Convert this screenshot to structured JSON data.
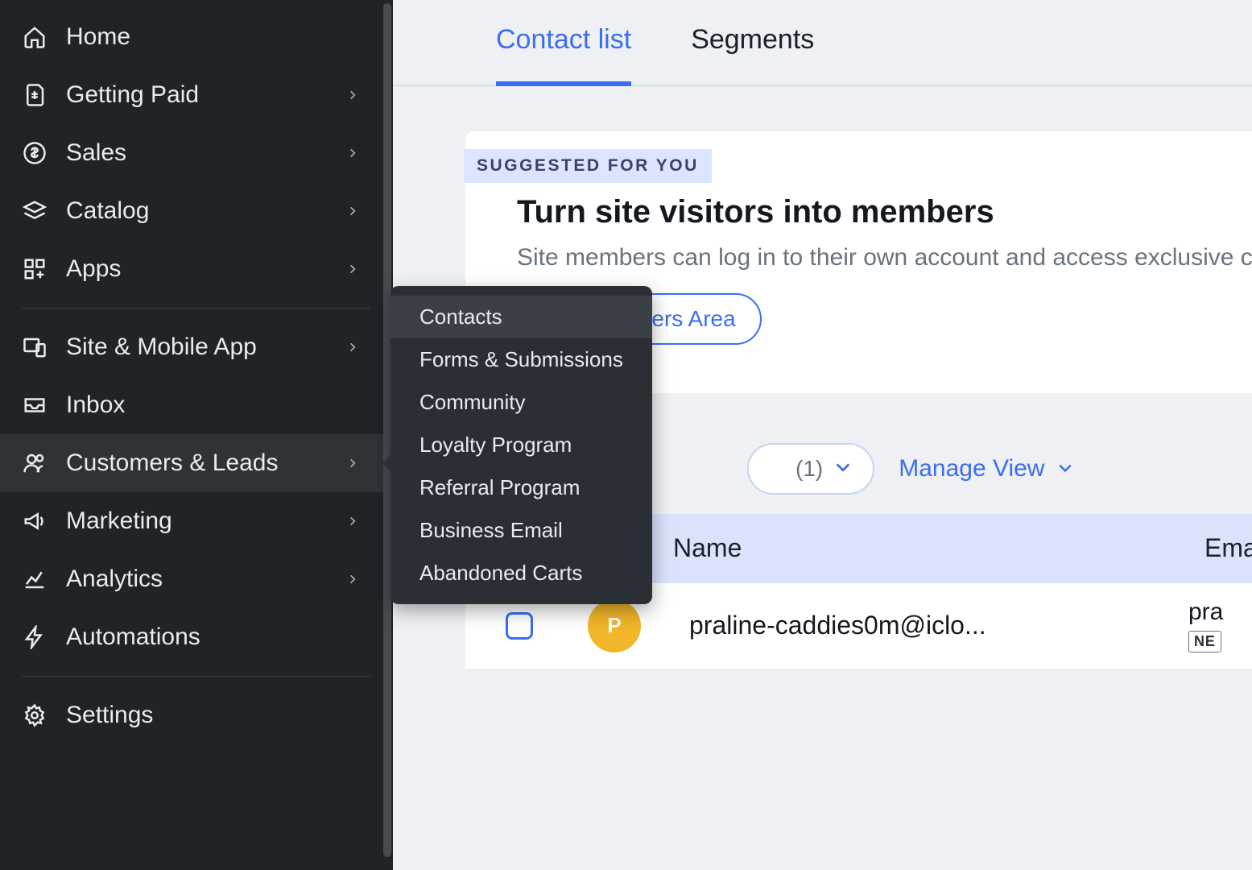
{
  "sidebar": {
    "items": [
      {
        "label": "Home",
        "icon": "home-icon",
        "hasChildren": false
      },
      {
        "label": "Getting Paid",
        "icon": "getting-paid-icon",
        "hasChildren": true
      },
      {
        "label": "Sales",
        "icon": "sales-icon",
        "hasChildren": true
      },
      {
        "label": "Catalog",
        "icon": "catalog-icon",
        "hasChildren": true
      },
      {
        "label": "Apps",
        "icon": "apps-icon",
        "hasChildren": true
      },
      {
        "label": "Site & Mobile App",
        "icon": "site-mobile-icon",
        "hasChildren": true
      },
      {
        "label": "Inbox",
        "icon": "inbox-icon",
        "hasChildren": false
      },
      {
        "label": "Customers & Leads",
        "icon": "customers-icon",
        "hasChildren": true,
        "active": true
      },
      {
        "label": "Marketing",
        "icon": "marketing-icon",
        "hasChildren": true
      },
      {
        "label": "Analytics",
        "icon": "analytics-icon",
        "hasChildren": true
      },
      {
        "label": "Automations",
        "icon": "automations-icon",
        "hasChildren": false
      },
      {
        "label": "Settings",
        "icon": "settings-icon",
        "hasChildren": false
      }
    ],
    "dividers_after": [
      4,
      10
    ]
  },
  "submenu": {
    "items": [
      {
        "label": "Contacts",
        "active": true
      },
      {
        "label": "Forms & Submissions"
      },
      {
        "label": "Community"
      },
      {
        "label": "Loyalty Program"
      },
      {
        "label": "Referral Program"
      },
      {
        "label": "Business Email"
      },
      {
        "label": "Abandoned Carts"
      }
    ]
  },
  "tabs": [
    {
      "label": "Contact list",
      "active": true
    },
    {
      "label": "Segments"
    }
  ],
  "card": {
    "badge": "SUGGESTED FOR YOU",
    "title": "Turn site visitors into members",
    "description": "Site members can log in to their own account and access exclusive content.",
    "cta": "Add Members Area"
  },
  "toolbar": {
    "filter_count": "(1)",
    "manage_view": "Manage View"
  },
  "table": {
    "headers": {
      "name": "Name",
      "email": "Email"
    },
    "rows": [
      {
        "initial": "P",
        "name": "praline-caddies0m@iclo...",
        "email_preview": "pra",
        "tag": "NE"
      }
    ]
  },
  "colors": {
    "accent": "#3b6df0",
    "sidebar_bg": "#1f2429",
    "avatar": "#f1b62a"
  }
}
